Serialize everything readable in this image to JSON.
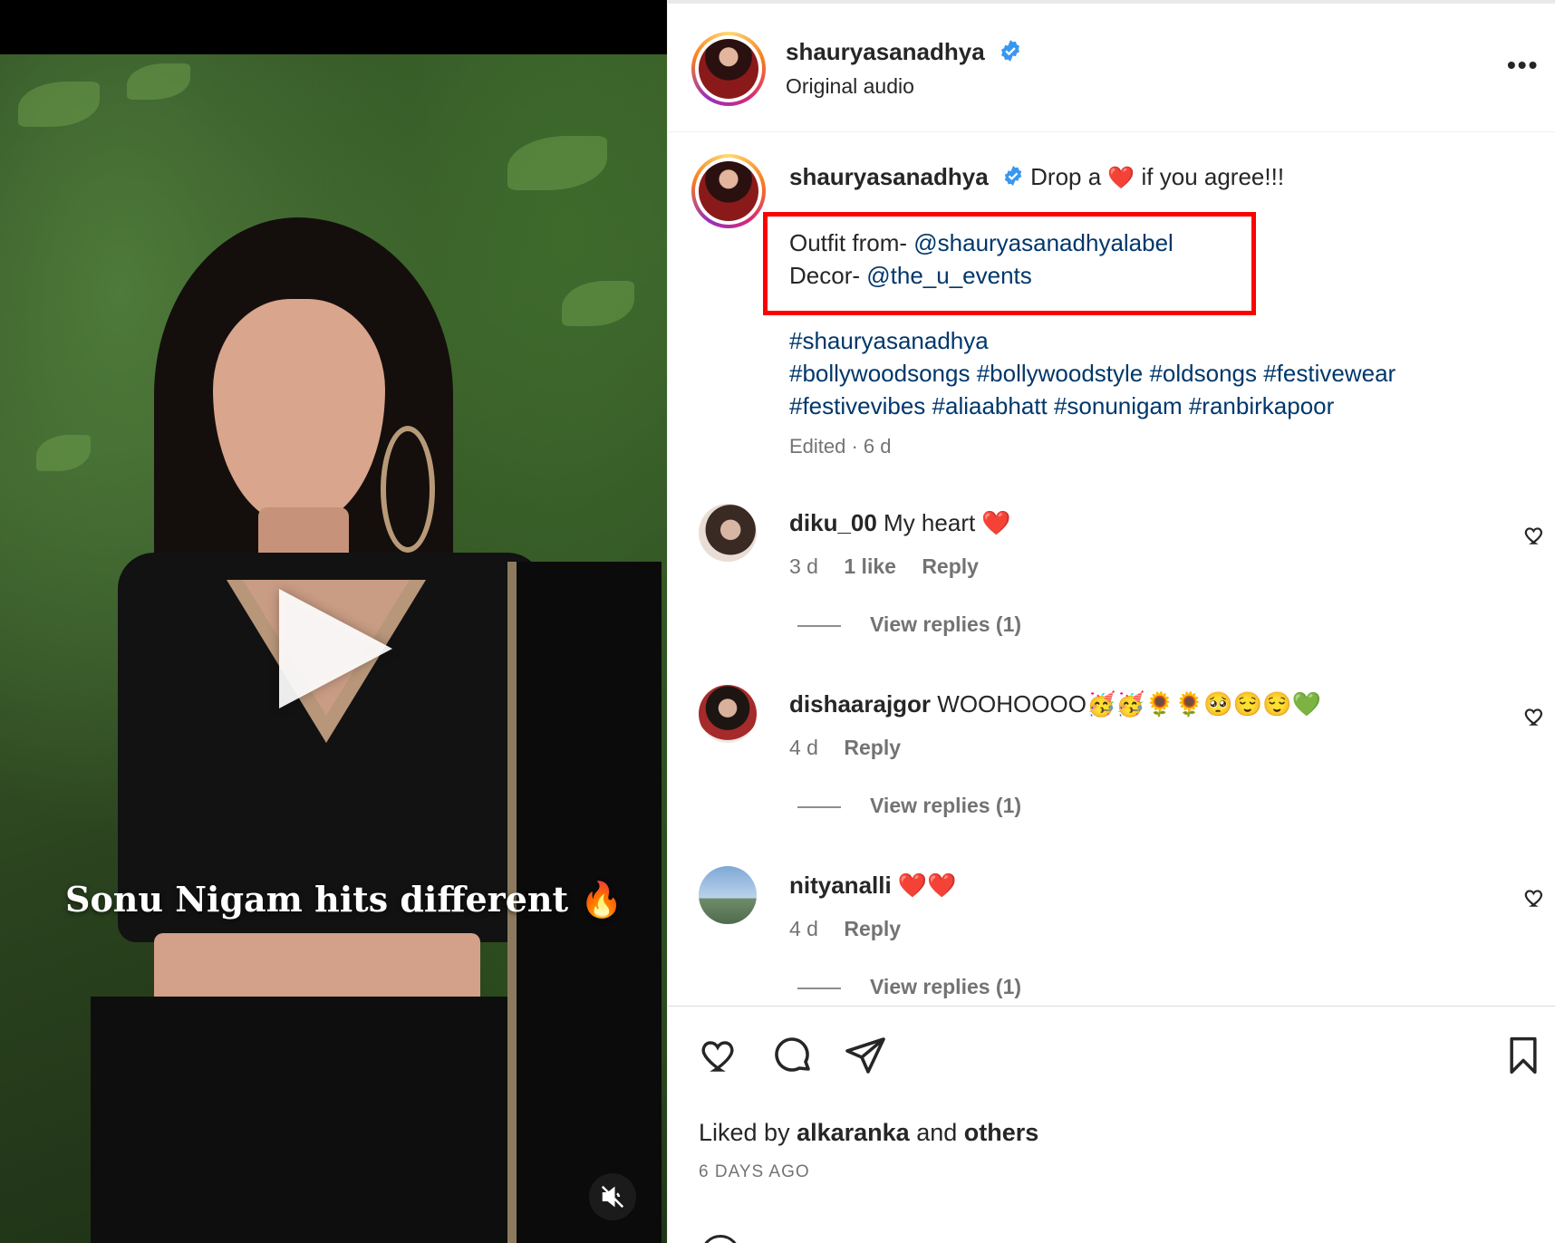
{
  "video": {
    "overlay_caption": "Sonu Nigam hits different 🔥"
  },
  "header": {
    "username": "shauryasanadhya",
    "subtitle": "Original audio",
    "more_label": "•••"
  },
  "caption": {
    "username": "shauryasanadhya",
    "text_before": "Drop a ",
    "heart": "❤️",
    "text_after": " if you agree!!!",
    "outfit_label": "Outfit from- ",
    "outfit_link": "@shauryasanadhyalabel",
    "decor_label": "Decor- ",
    "decor_link": "@the_u_events",
    "hashtags_line1": "#shauryasanadhya",
    "hashtags_line2": "#bollywoodsongs #bollywoodstyle #oldsongs #festivewear",
    "hashtags_line3": "#festivevibes #aliaabhatt #sonunigam #ranbirkapoor",
    "meta": "Edited · 6 d"
  },
  "comments": [
    {
      "username": "diku_00",
      "text": " My heart ❤️",
      "time": "3 d",
      "likes": "1 like",
      "reply": "Reply",
      "view_replies": "View replies (1)"
    },
    {
      "username": "dishaarajgor",
      "text": " WOOHOOOO🥳🥳🌻🌻🥺😌😌💚",
      "time": "4 d",
      "reply": "Reply",
      "view_replies": "View replies (1)"
    },
    {
      "username": "nityanalli",
      "text": " ❤️❤️",
      "time": "4 d",
      "reply": "Reply",
      "view_replies": "View replies (1)"
    }
  ],
  "footer": {
    "liked_prefix": "Liked by ",
    "liked_user": "alkaranka",
    "liked_mid": " and ",
    "liked_others": "others",
    "date": "6 DAYS AGO"
  },
  "colors": {
    "link": "#00376b",
    "verified": "#3897f0",
    "highlight": "#ff0000",
    "secondary_text": "#737373"
  },
  "icons": [
    "play-icon",
    "mute-icon",
    "verified-icon",
    "more-icon",
    "heart-icon",
    "comment-icon",
    "share-icon",
    "bookmark-icon"
  ]
}
